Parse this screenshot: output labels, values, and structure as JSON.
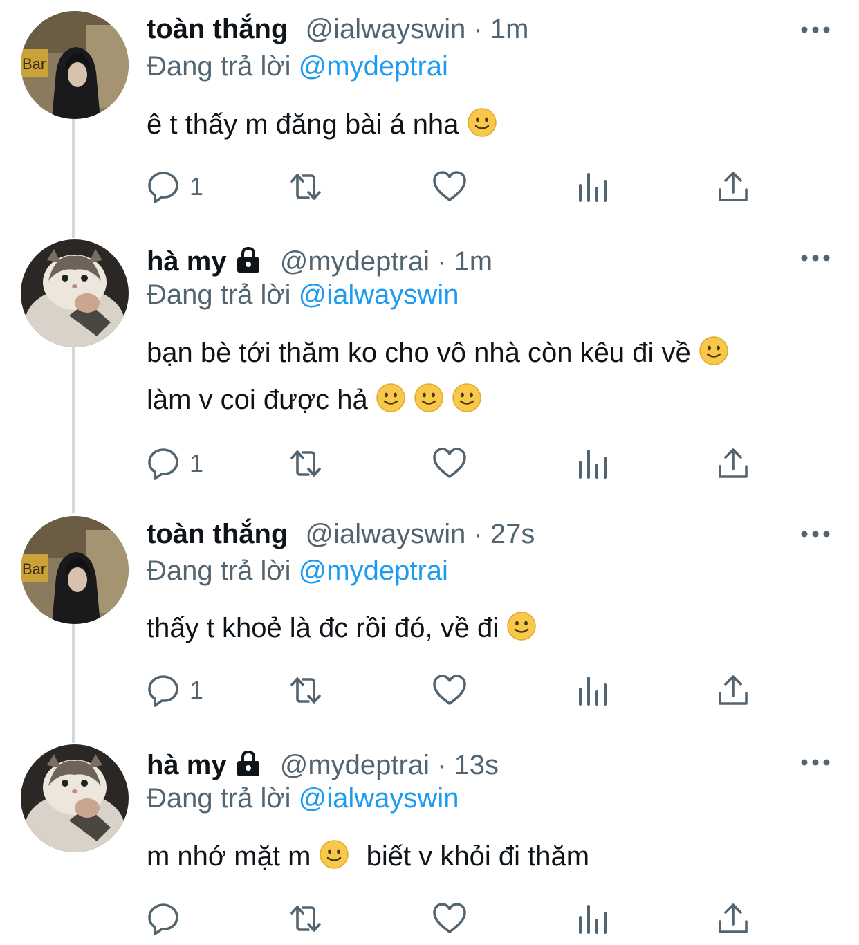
{
  "tweets": [
    {
      "name": "toàn thắng",
      "handle": "@ialwayswin",
      "separator": "·",
      "time": "1m",
      "locked": false,
      "avatar": "hooded-person-avatar",
      "reply_prefix": "Đang trả lời",
      "reply_to": "@mydeptrai",
      "lines": [
        "ê t thấy m đăng bài á nha"
      ],
      "reply_count": "1"
    },
    {
      "name": "hà my",
      "handle": "@mydeptrai",
      "separator": "·",
      "time": "1m",
      "locked": true,
      "avatar": "cat-avatar",
      "reply_prefix": "Đang trả lời",
      "reply_to": "@ialwayswin",
      "lines": [
        "bạn bè tới thăm ko cho vô nhà còn kêu đi về",
        "làm v coi được hả"
      ],
      "reply_count": "1"
    },
    {
      "name": "toàn thắng",
      "handle": "@ialwayswin",
      "separator": "·",
      "time": "27s",
      "locked": false,
      "avatar": "hooded-person-avatar",
      "reply_prefix": "Đang trả lời",
      "reply_to": "@mydeptrai",
      "lines": [
        "thấy t khoẻ là đc rồi đó, về đi"
      ],
      "reply_count": "1"
    },
    {
      "name": "hà my",
      "handle": "@mydeptrai",
      "separator": "·",
      "time": "13s",
      "locked": true,
      "avatar": "cat-avatar",
      "reply_prefix": "Đang trả lời",
      "reply_to": "@ialwayswin",
      "lines": [
        "m nhớ mặt m",
        "biết v khỏi đi thăm"
      ],
      "reply_count": ""
    }
  ],
  "icons": {
    "reply": "reply-icon",
    "retweet": "retweet-icon",
    "like": "heart-icon",
    "views": "analytics-icon",
    "share": "share-icon",
    "more": "more-icon",
    "lock": "lock-icon",
    "emoji": "slightly-smiling-face-emoji"
  },
  "colors": {
    "text": "#0f1419",
    "secondary": "#536471",
    "link": "#1d9bf0",
    "thread_line": "#cfd9de"
  }
}
